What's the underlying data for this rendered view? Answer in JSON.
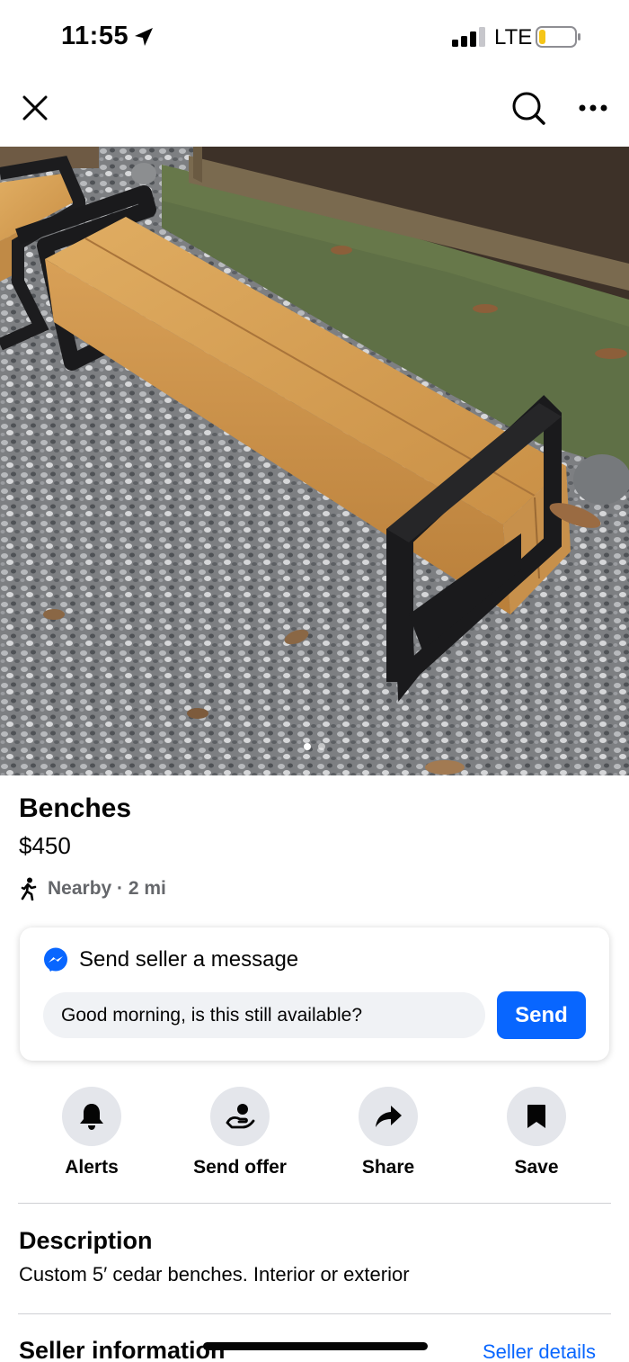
{
  "status_bar": {
    "time": "11:55",
    "network": "LTE",
    "signal_bars_active": 3,
    "signal_bars_total": 4,
    "battery_level": 0.15
  },
  "nav": {
    "close_icon": "close-icon",
    "search_icon": "search-icon",
    "more_icon": "more-horizontal-icon"
  },
  "photo": {
    "subject": "cedar bench image",
    "page_dots": 2,
    "active_dot": 1
  },
  "listing": {
    "title": "Benches",
    "price": "$450",
    "location": "Nearby · 2 mi"
  },
  "message": {
    "title": "Send seller a message",
    "input_value": "Good morning, is this still available?",
    "send_label": "Send"
  },
  "actions": [
    {
      "label": "Alerts",
      "icon": "bell-icon"
    },
    {
      "label": "Send offer",
      "icon": "offer-hand-icon"
    },
    {
      "label": "Share",
      "icon": "share-arrow-icon"
    },
    {
      "label": "Save",
      "icon": "bookmark-icon"
    }
  ],
  "description": {
    "heading": "Description",
    "text": "Custom 5′ cedar benches. Interior or exterior"
  },
  "seller": {
    "heading": "Seller information",
    "link": "Seller details"
  },
  "colors": {
    "accent": "#0866ff",
    "secondary_text": "#65676b",
    "action_bg": "#e4e6eb",
    "input_bg": "#f0f2f5"
  }
}
